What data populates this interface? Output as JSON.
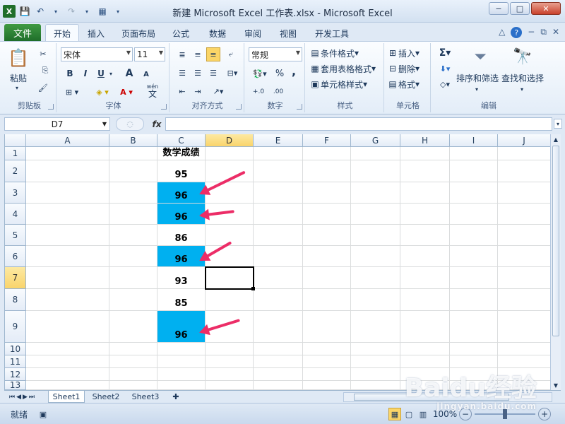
{
  "window": {
    "title": "新建 Microsoft Excel 工作表.xlsx - Microsoft Excel",
    "min": "−",
    "max": "□",
    "close": "✕"
  },
  "tabs": {
    "file": "文件",
    "items": [
      "开始",
      "插入",
      "页面布局",
      "公式",
      "数据",
      "审阅",
      "视图",
      "开发工具"
    ]
  },
  "ribbon": {
    "clipboard": {
      "label": "剪贴板",
      "paste": "粘贴"
    },
    "font": {
      "label": "字体",
      "name": "宋体",
      "size": "11",
      "bold": "B",
      "italic": "I",
      "underline": "U",
      "grow": "A",
      "shrink": "A",
      "wen": "wén",
      "wenchar": "文"
    },
    "align": {
      "label": "对齐方式"
    },
    "number": {
      "label": "数字",
      "format": "常规",
      "percent": "%",
      "comma": ","
    },
    "styles": {
      "label": "样式",
      "cond": "条件格式",
      "table": "套用表格格式",
      "cell": "单元格样式"
    },
    "cells": {
      "label": "单元格",
      "insert": "插入",
      "delete": "删除",
      "format": "格式"
    },
    "edit": {
      "label": "编辑",
      "sort": "排序和筛选",
      "find": "查找和选择"
    }
  },
  "formula": {
    "namebox": "D7",
    "fx": "fx"
  },
  "grid": {
    "columns": [
      "A",
      "B",
      "C",
      "D",
      "E",
      "F",
      "G",
      "H",
      "I",
      "J"
    ],
    "rows": [
      "1",
      "2",
      "3",
      "4",
      "5",
      "6",
      "7",
      "8",
      "9",
      "10",
      "11",
      "12",
      "13"
    ],
    "cells": {
      "C1": "数学成绩",
      "C2": "95",
      "C3": "96",
      "C4": "96",
      "C5": "86",
      "C6": "96",
      "C7": "93",
      "C8": "85",
      "C9": "96"
    },
    "highlight_color": "#00b0f0",
    "arrow_color": "#ec2d67"
  },
  "sheets": [
    "Sheet1",
    "Sheet2",
    "Sheet3"
  ],
  "status": {
    "ready": "就绪",
    "zoom": "100%",
    "minus": "−",
    "plus": "+"
  },
  "watermark": {
    "main": "Baidu经验",
    "sub": "jingyan.baidu.com"
  }
}
